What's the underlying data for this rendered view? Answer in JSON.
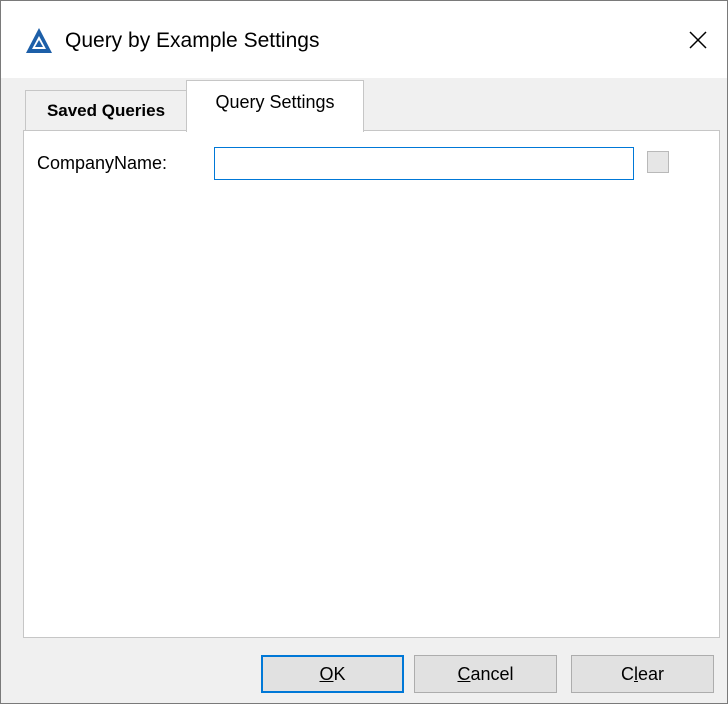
{
  "dialog": {
    "title": "Query by Example Settings",
    "app_icon": "app-logo-icon",
    "close_icon": "close-icon"
  },
  "tabs": [
    {
      "label": "Saved Queries",
      "selected": false
    },
    {
      "label": "Query Settings",
      "selected": true
    }
  ],
  "query_settings": {
    "field_label": "CompanyName:",
    "field_value": "",
    "field_placeholder": "",
    "checkbox_checked": false
  },
  "buttons": {
    "ok": {
      "mnemonic": "O",
      "rest": "K"
    },
    "cancel": {
      "mnemonic": "C",
      "rest": "ancel"
    },
    "clear": {
      "first": "C",
      "mnemonic": "l",
      "rest": "ear"
    }
  },
  "colors": {
    "accent": "#0078d7",
    "logo": "#1d5fa8"
  }
}
